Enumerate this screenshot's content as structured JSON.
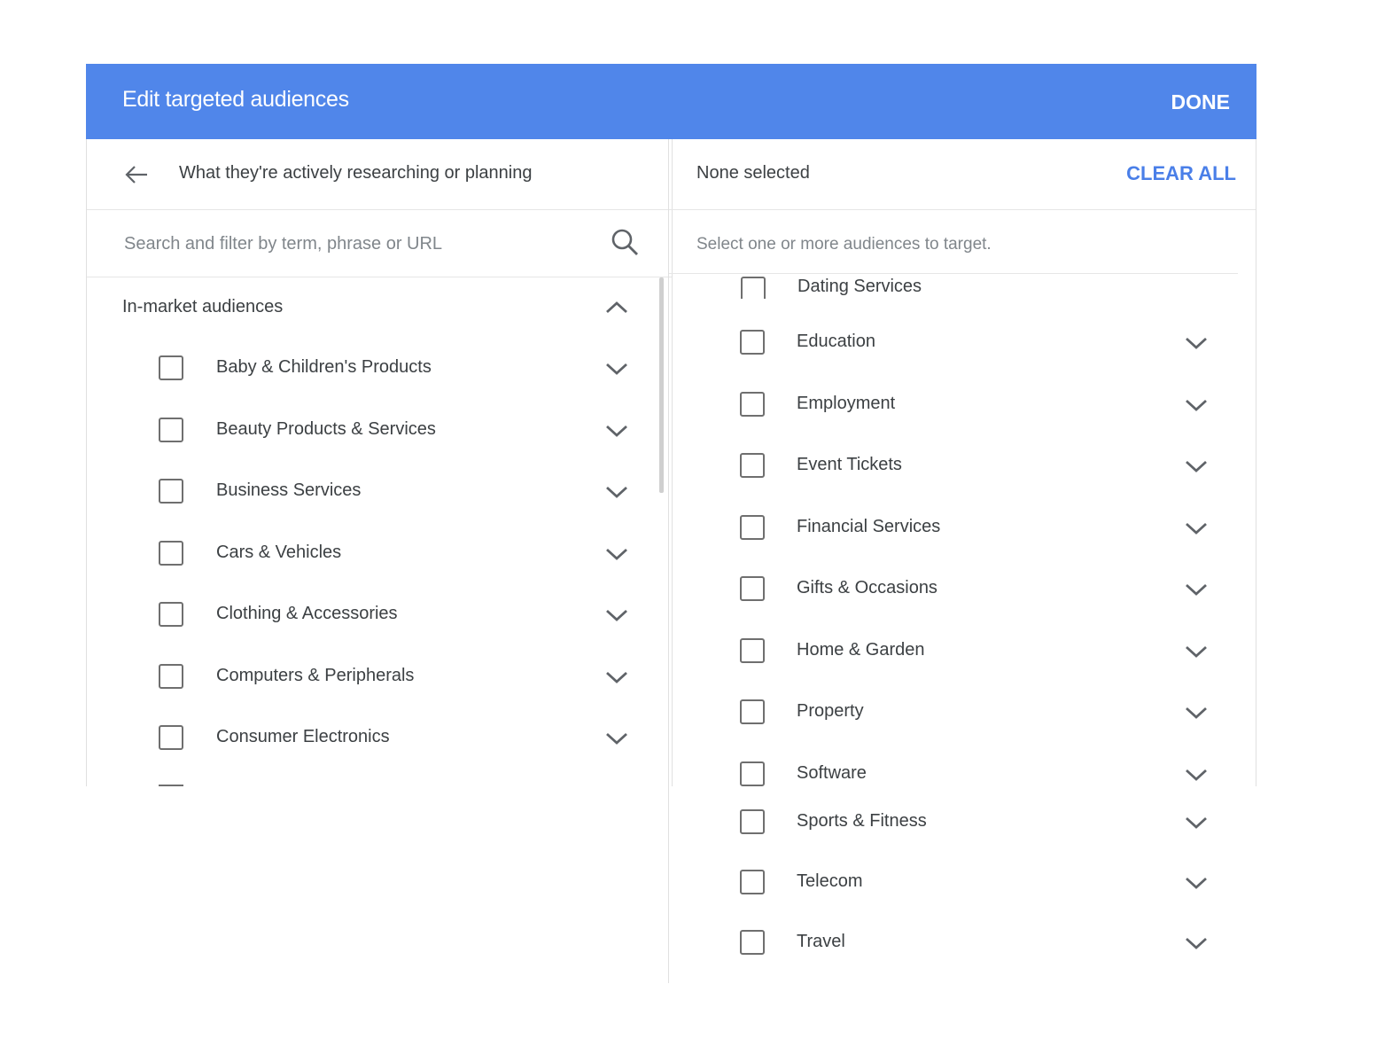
{
  "dialog": {
    "title": "Edit targeted audiences",
    "done_label": "DONE"
  },
  "left": {
    "nav_title": "What they're actively researching or planning",
    "search_placeholder": "Search and filter by term, phrase or URL",
    "section_label": "In-market audiences",
    "items": [
      {
        "label": "Baby & Children's Products"
      },
      {
        "label": "Beauty Products & Services"
      },
      {
        "label": "Business Services"
      },
      {
        "label": "Cars & Vehicles"
      },
      {
        "label": "Clothing & Accessories"
      },
      {
        "label": "Computers & Peripherals"
      },
      {
        "label": "Consumer Electronics"
      }
    ]
  },
  "right": {
    "selection_status": "None selected",
    "clear_all_label": "CLEAR ALL",
    "hint": "Select one or more audiences to target.",
    "items": [
      {
        "label": "Dating Services"
      },
      {
        "label": "Education"
      },
      {
        "label": "Employment"
      },
      {
        "label": "Event Tickets"
      },
      {
        "label": "Financial Services"
      },
      {
        "label": "Gifts & Occasions"
      },
      {
        "label": "Home & Garden"
      },
      {
        "label": "Property"
      },
      {
        "label": "Software"
      },
      {
        "label": "Sports & Fitness"
      },
      {
        "label": "Telecom"
      },
      {
        "label": "Travel"
      }
    ]
  },
  "colors": {
    "header": "#5086ea",
    "accent": "#4a7fe8"
  }
}
